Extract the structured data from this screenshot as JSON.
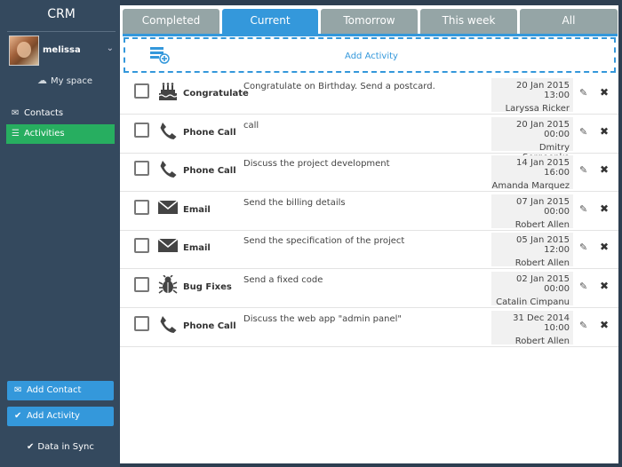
{
  "app": {
    "title": "CRM"
  },
  "user": {
    "name": "melissa"
  },
  "sidebar": {
    "my_space": "My space",
    "nav": [
      {
        "label": "Contacts",
        "icon": "envelope-icon"
      },
      {
        "label": "Activities",
        "icon": "list-icon"
      }
    ],
    "add_contact": "Add Contact",
    "add_activity": "Add Activity",
    "sync": "Data in Sync",
    "active_color": "#27ae60",
    "button_color": "#3498db"
  },
  "tabs": [
    {
      "label": "Completed"
    },
    {
      "label": "Current"
    },
    {
      "label": "Tomorrow"
    },
    {
      "label": "This week"
    },
    {
      "label": "All"
    }
  ],
  "active_tab": "Current",
  "add_activity_label": "Add Activity",
  "activities": [
    {
      "type": "Congratulate",
      "icon": "cake-icon",
      "description": "Congratulate on Birthday. Send a postcard.",
      "date": "20 Jan 2015 13:00",
      "contact": "Laryssa Ricker"
    },
    {
      "type": "Phone Call",
      "icon": "phone-icon",
      "description": "call",
      "date": "20 Jan 2015 00:00",
      "contact": "Dmitry Sergeenko"
    },
    {
      "type": "Phone Call",
      "icon": "phone-icon",
      "description": "Discuss the project development",
      "date": "14 Jan 2015 16:00",
      "contact": "Amanda Marquez"
    },
    {
      "type": "Email",
      "icon": "mail-icon",
      "description": "Send the billing details",
      "date": "07 Jan 2015 00:00",
      "contact": "Robert Allen"
    },
    {
      "type": "Email",
      "icon": "mail-icon",
      "description": "Send the specification of the project",
      "date": "05 Jan 2015 12:00",
      "contact": "Robert Allen"
    },
    {
      "type": "Bug Fixes",
      "icon": "bug-icon",
      "description": "Send a fixed code",
      "date": "02 Jan 2015 00:00",
      "contact": "Catalin Cimpanu"
    },
    {
      "type": "Phone Call",
      "icon": "phone-icon",
      "description": "Discuss the web app \"admin panel\"",
      "date": "31 Dec 2014 10:00",
      "contact": "Robert Allen"
    }
  ]
}
